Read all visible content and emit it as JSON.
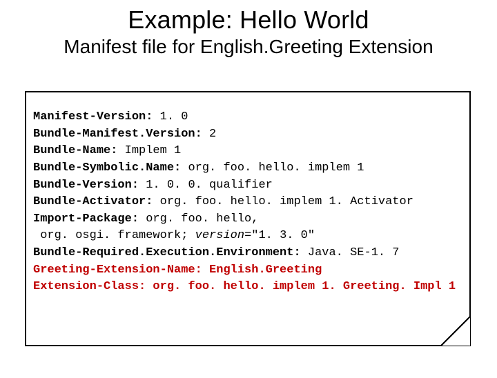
{
  "title": "Example: Hello World",
  "subtitle": "Manifest file for English.Greeting Extension",
  "code": {
    "l1k": "Manifest-Version:",
    "l1v": " 1. 0",
    "l2k": "Bundle-Manifest.Version:",
    "l2v": " 2",
    "l3k": "Bundle-Name:",
    "l3v": " Implem 1",
    "l4k": "Bundle-Symbolic.Name:",
    "l4v": " org. foo. hello. implem 1",
    "l5k": "Bundle-Version:",
    "l5v": " 1. 0. 0. qualifier",
    "l6k": "Bundle-Activator:",
    "l6v": " org. foo. hello. implem 1. Activator",
    "l7k": "Import-Package:",
    "l7v": " org. foo. hello,",
    "l8a": " org. osgi. framework; ",
    "l8i": "version",
    "l8b": "=\"1. 3. 0\"",
    "l9k": "Bundle-Required.Execution.Environment:",
    "l9v": " Java. SE-1. 7",
    "l10": "Greeting-Extension-Name: English.Greeting",
    "l11": "Extension-Class: org. foo. hello. implem 1. Greeting. Impl 1"
  }
}
